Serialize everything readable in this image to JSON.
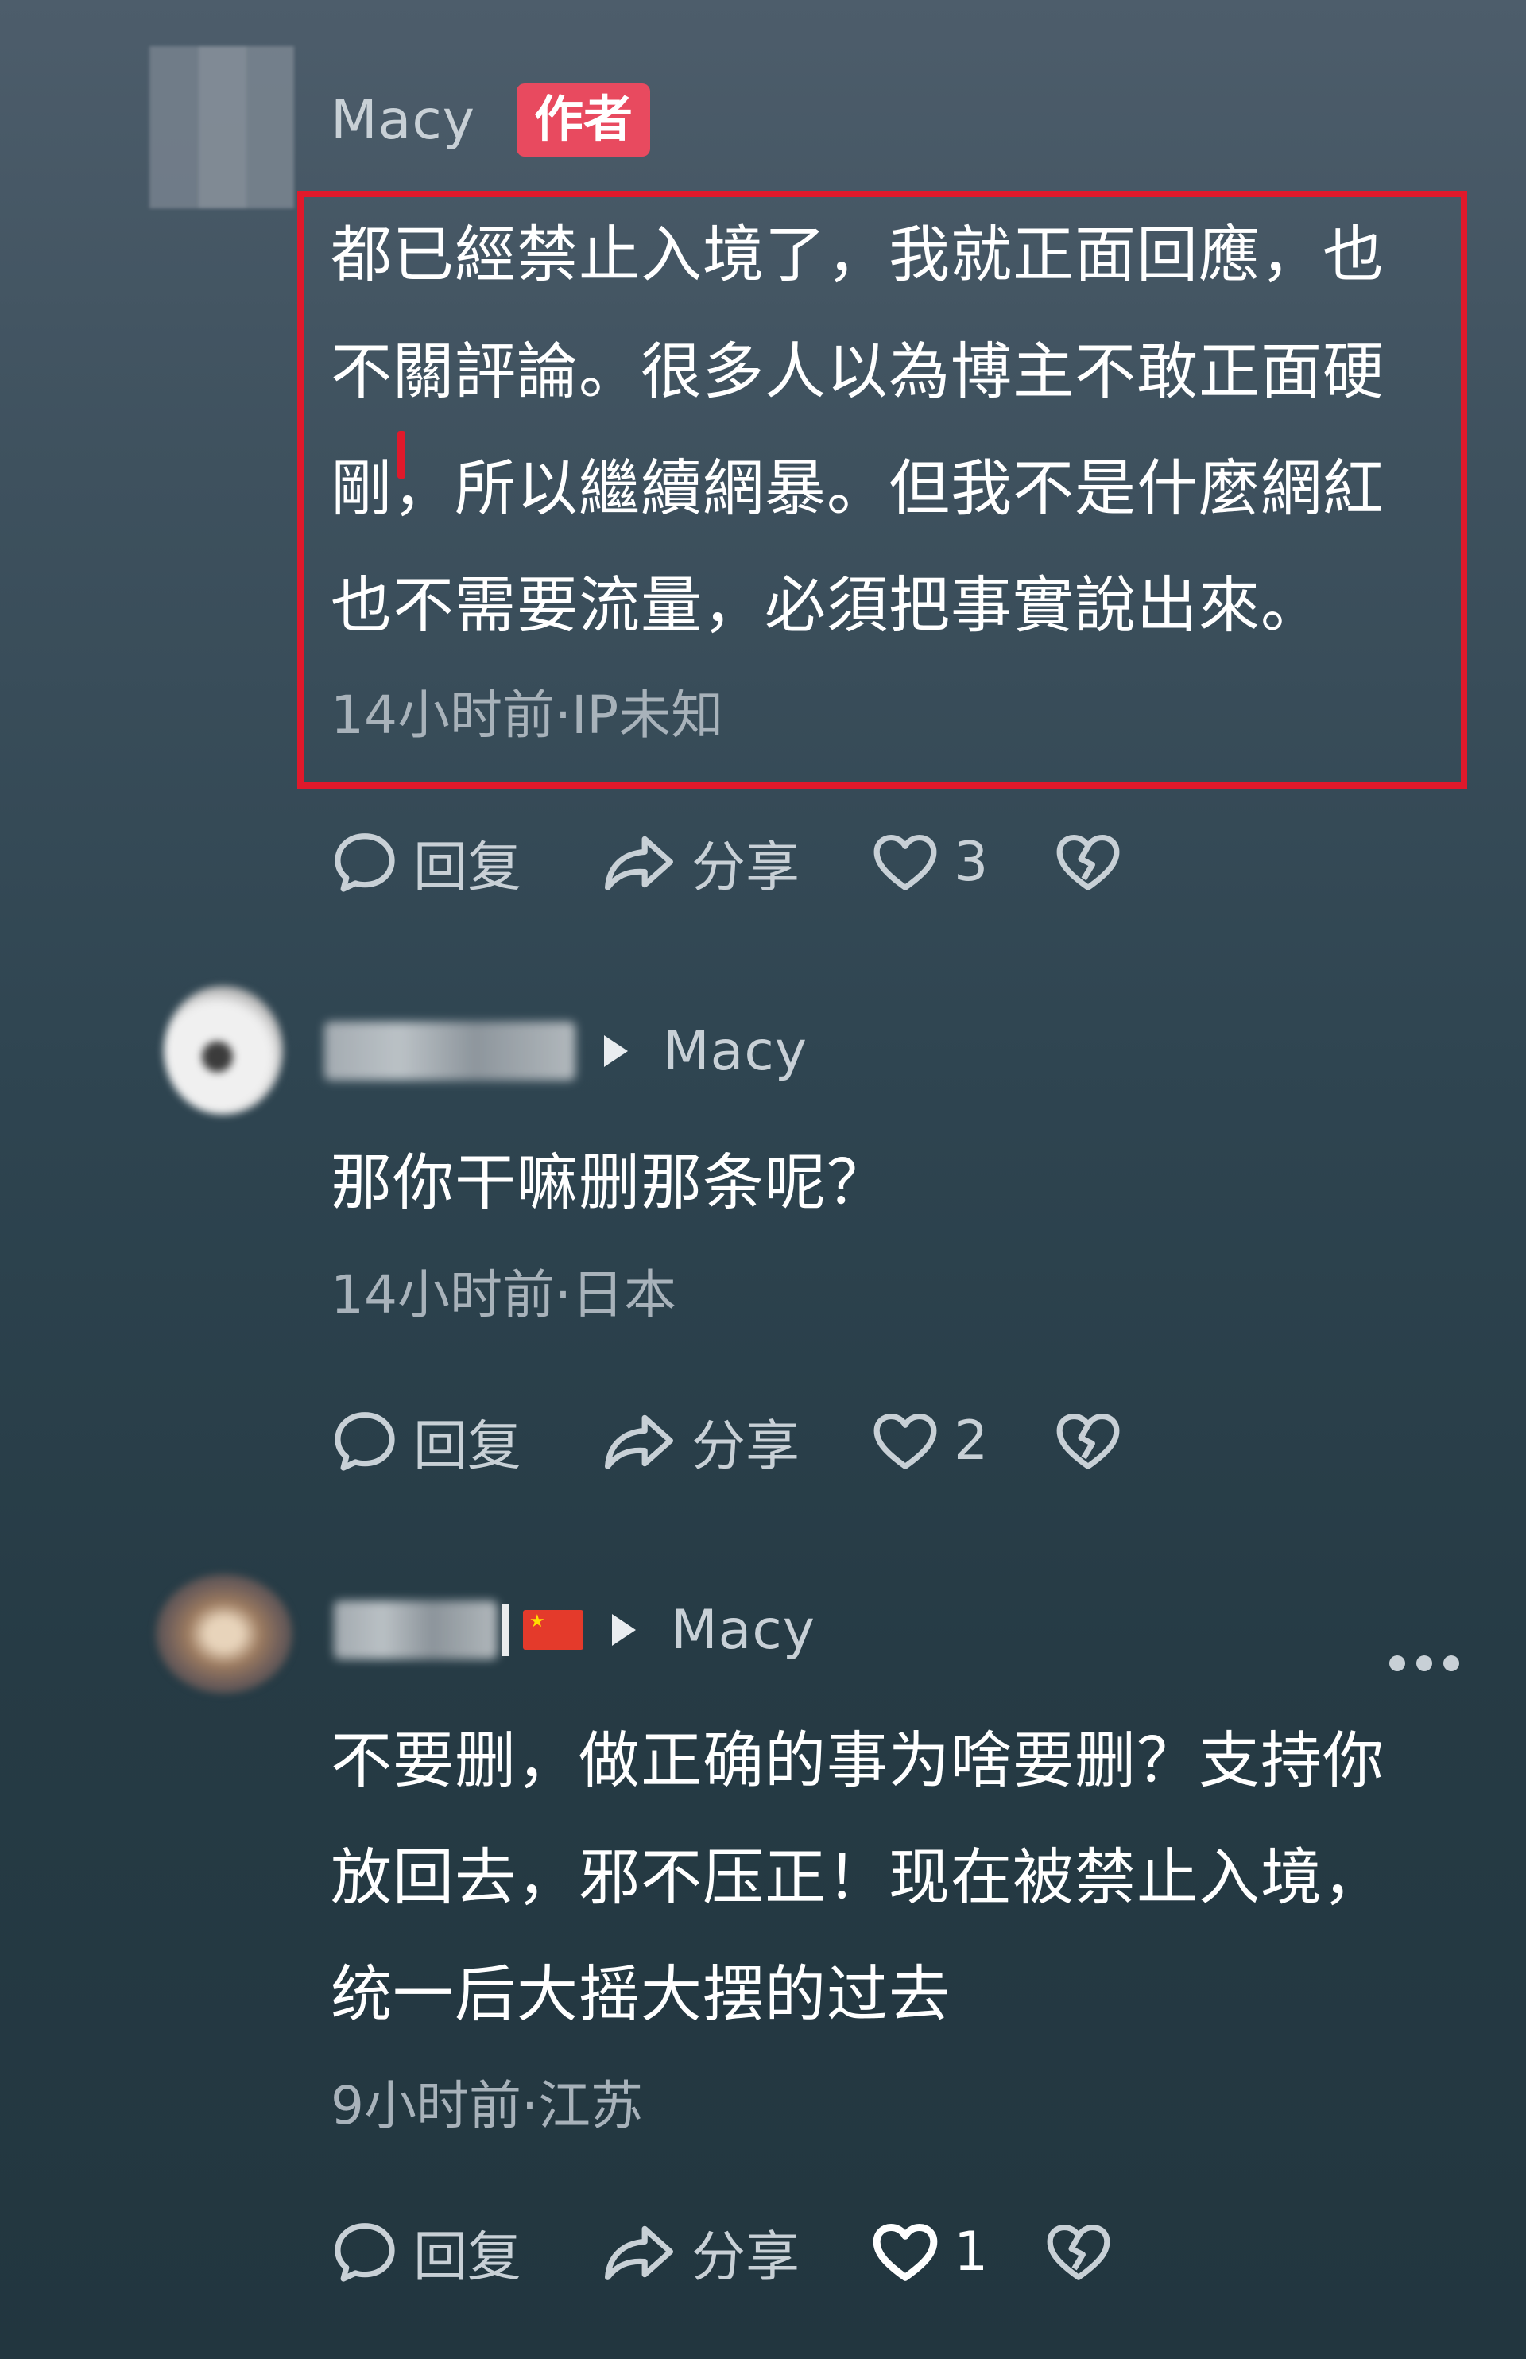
{
  "comments": [
    {
      "name": "Macy",
      "badge": "作者",
      "lines": [
        "都已經禁止入境了，我就正面回應，也",
        "不關評論。很多人以為博主不敢正面硬",
        "剛，所以繼續網暴。但我不是什麼網紅",
        "也不需要流量，必須把事實說出來。"
      ],
      "meta": "14小时前·IP未知",
      "reply_label": "回复",
      "share_label": "分享",
      "likes": "3",
      "highlighted": true
    },
    {
      "reply_to": "Macy",
      "lines": [
        "那你干嘛删那条呢？"
      ],
      "meta": "14小时前·日本",
      "reply_label": "回复",
      "share_label": "分享",
      "likes": "2"
    },
    {
      "reply_to": "Macy",
      "lines": [
        "不要删，做正确的事为啥要删？支持你",
        "放回去，邪不压正！现在被禁止入境，",
        "统一后大摇大摆的过去"
      ],
      "meta": "9小时前·江苏",
      "reply_label": "回复",
      "share_label": "分享",
      "likes": "1",
      "liked": true
    }
  ],
  "colors": {
    "author_badge": "#e84a5f",
    "highlight_border": "#e0192b",
    "secondary_text": "#a8b2ba"
  },
  "icons": [
    "comment-icon",
    "share-icon",
    "heart-icon",
    "dislike-icon",
    "more-icon",
    "play-arrow-icon",
    "china-flag-icon"
  ]
}
